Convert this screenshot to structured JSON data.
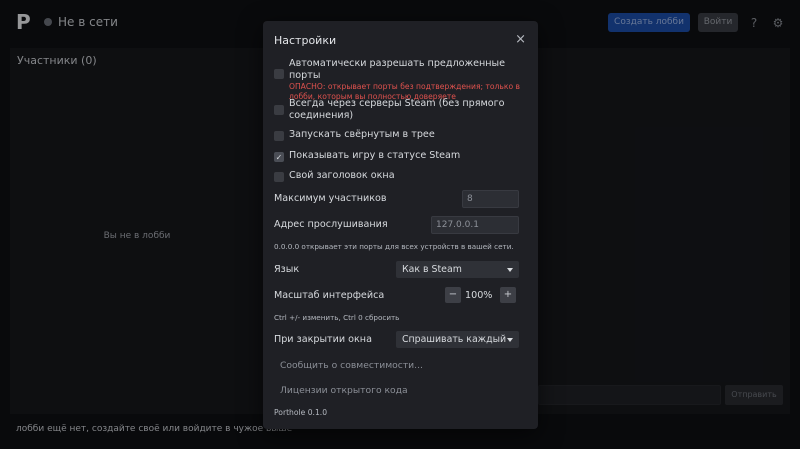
{
  "app": {
    "logo": "P",
    "status_text": "Не в сети",
    "create_lobby_label": "Создать лобби",
    "join_label": "Войти",
    "help_icon_glyph": "?",
    "settings_icon_glyph": "⚙"
  },
  "participants": {
    "title": "Участники (0)",
    "empty_text": "Вы не в лобби"
  },
  "chat": {
    "send_label": "Отправить"
  },
  "footer": {
    "text": "лобби ещё нет, создайте своё или войдите в чужое выше"
  },
  "settings": {
    "title": "Настройки",
    "close_glyph": "×",
    "auto_ports": {
      "label": "Автоматически разрешать предложенные порты",
      "warning": "ОПАСНО: открывает порты без подтверждения; только в лобби, которым вы полностью доверяете",
      "checked": false
    },
    "steam_relay": {
      "label": "Всегда через серверы Steam (без прямого соединения)",
      "checked": false
    },
    "start_minimized": {
      "label": "Запускать свёрнутым в трее",
      "checked": false
    },
    "show_in_steam": {
      "label": "Показывать игру в статусе Steam",
      "checked": true,
      "check_glyph": "✓"
    },
    "custom_titlebar": {
      "label": "Свой заголовок окна",
      "checked": false
    },
    "max_participants": {
      "label": "Максимум участников",
      "value": "8"
    },
    "listen_address": {
      "label": "Адрес прослушивания",
      "value": "127.0.0.1",
      "hint": "0.0.0.0 открывает эти порты для всех устройств в вашей сети."
    },
    "language": {
      "label": "Язык",
      "value": "Как в Steam"
    },
    "ui_scale": {
      "label": "Масштаб интерфейса",
      "value": "100%",
      "minus": "−",
      "plus": "+",
      "hint": "Ctrl +/- изменить, Ctrl 0 сбросить"
    },
    "on_close": {
      "label": "При закрытии окна",
      "value": "Спрашивать каждый"
    },
    "report_compat_label": "Сообщить о совместимости...",
    "licenses_label": "Лицензии открытого кода",
    "version": "Porthole 0.1.0"
  },
  "colors": {
    "accent": "#1d4ea8",
    "warning": "#e0524e",
    "modal_bg": "#1f2025",
    "app_bg": "#0f1013"
  }
}
